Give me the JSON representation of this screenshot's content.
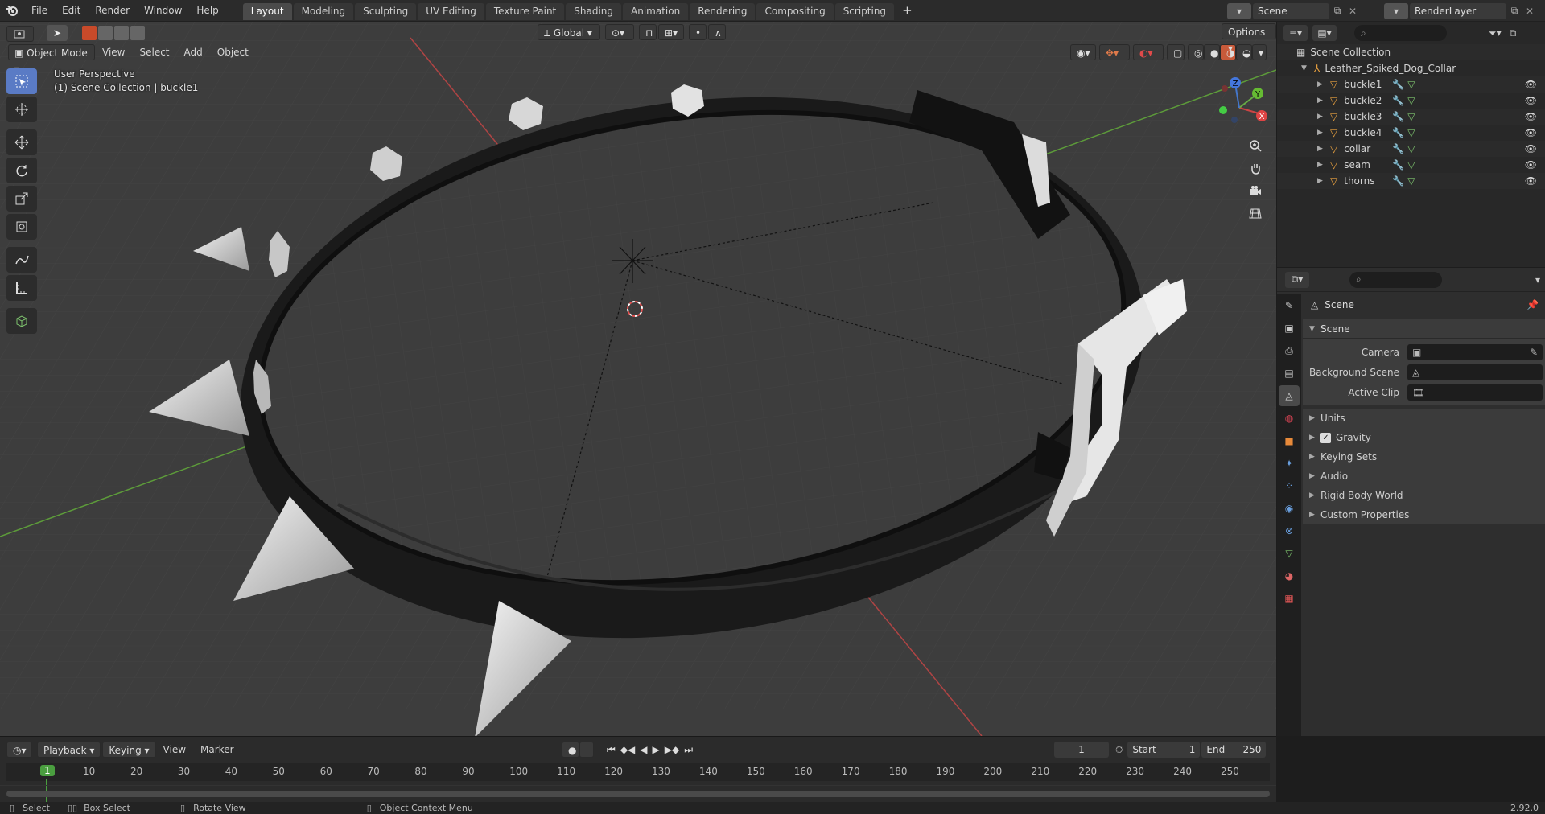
{
  "top_menu": [
    "File",
    "Edit",
    "Render",
    "Window",
    "Help"
  ],
  "workspaces": [
    "Layout",
    "Modeling",
    "Sculpting",
    "UV Editing",
    "Texture Paint",
    "Shading",
    "Animation",
    "Rendering",
    "Compositing",
    "Scripting"
  ],
  "active_workspace": "Layout",
  "add_workspace": "+",
  "scene_name": "Scene",
  "view_layer": "RenderLayer",
  "viewport": {
    "mode": "Object Mode",
    "menus": [
      "View",
      "Select",
      "Add",
      "Object"
    ],
    "transform_orientation": "Global",
    "options_label": "Options",
    "overlay_view": "User Perspective",
    "overlay_collection": "(1) Scene Collection | buckle1",
    "gizmo": {
      "x": "X",
      "y": "Y",
      "z": "Z"
    }
  },
  "outliner": {
    "root": "Scene Collection",
    "collection": "Leather_Spiked_Dog_Collar",
    "objects": [
      "buckle1",
      "buckle2",
      "buckle3",
      "buckle4",
      "collar",
      "seam",
      "thorns"
    ]
  },
  "properties": {
    "panel_title": "Scene",
    "section_scene": "Scene",
    "fields": {
      "camera_label": "Camera",
      "background_label": "Background Scene",
      "clip_label": "Active Clip"
    },
    "subpanels": [
      "Units",
      "Gravity",
      "Keying Sets",
      "Audio",
      "Rigid Body World",
      "Custom Properties"
    ]
  },
  "timeline": {
    "menus": [
      "Playback",
      "Keying",
      "View",
      "Marker"
    ],
    "current_frame": "1",
    "start_label": "Start",
    "start": "1",
    "end_label": "End",
    "end": "250",
    "ticks": [
      "1",
      "10",
      "20",
      "30",
      "40",
      "50",
      "60",
      "70",
      "80",
      "90",
      "100",
      "110",
      "120",
      "130",
      "140",
      "150",
      "160",
      "170",
      "180",
      "190",
      "200",
      "210",
      "220",
      "230",
      "240",
      "250"
    ]
  },
  "status": {
    "select": "Select",
    "box_select": "Box Select",
    "rotate": "Rotate View",
    "context": "Object Context Menu",
    "version": "2.92.0"
  },
  "colors": {
    "accent": "#5a7bc5",
    "active_frame": "#4a9e3f",
    "axis_x": "#c04040",
    "axis_y": "#5a9e3a"
  }
}
